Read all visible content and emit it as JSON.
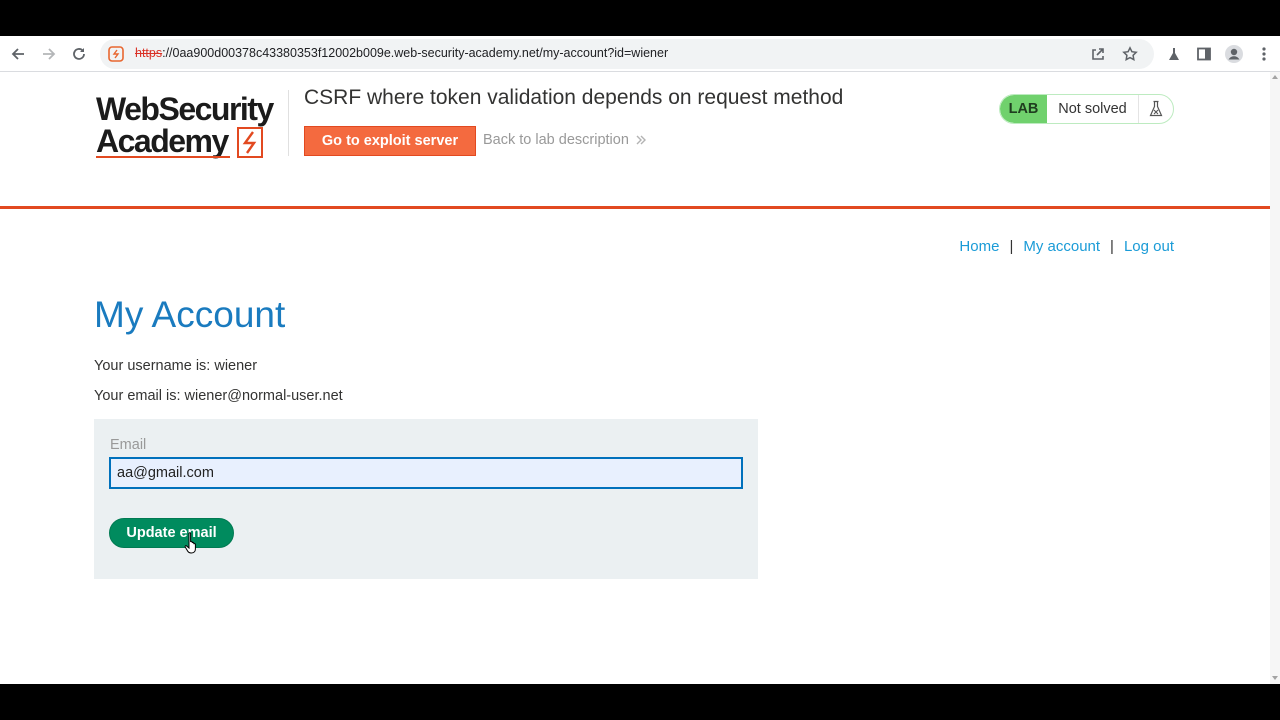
{
  "browser": {
    "url_scheme": "https",
    "url_rest": "://0aa900d00378c43380353f12002b009e.web-security-academy.net/my-account?id=wiener"
  },
  "header": {
    "logo_line1": "WebSecurity",
    "logo_line2": "Academy",
    "lab_title": "CSRF where token validation depends on request method",
    "exploit_button": "Go to exploit server",
    "back_link": "Back to lab description",
    "lab_tag": "LAB",
    "lab_status": "Not solved"
  },
  "nav": {
    "home": "Home",
    "separator": "|",
    "my_account": "My account",
    "log_out": "Log out"
  },
  "main": {
    "heading": "My Account",
    "username_line": "Your username is: wiener",
    "email_line": "Your email is: wiener@normal-user.net",
    "email_label": "Email",
    "email_value": "aa@gmail.com",
    "update_button": "Update email"
  },
  "colors": {
    "accent_orange": "#f46a3f",
    "lab_green": "#70d16d",
    "heading_blue": "#1a7bbf",
    "button_green": "#008b5e"
  }
}
